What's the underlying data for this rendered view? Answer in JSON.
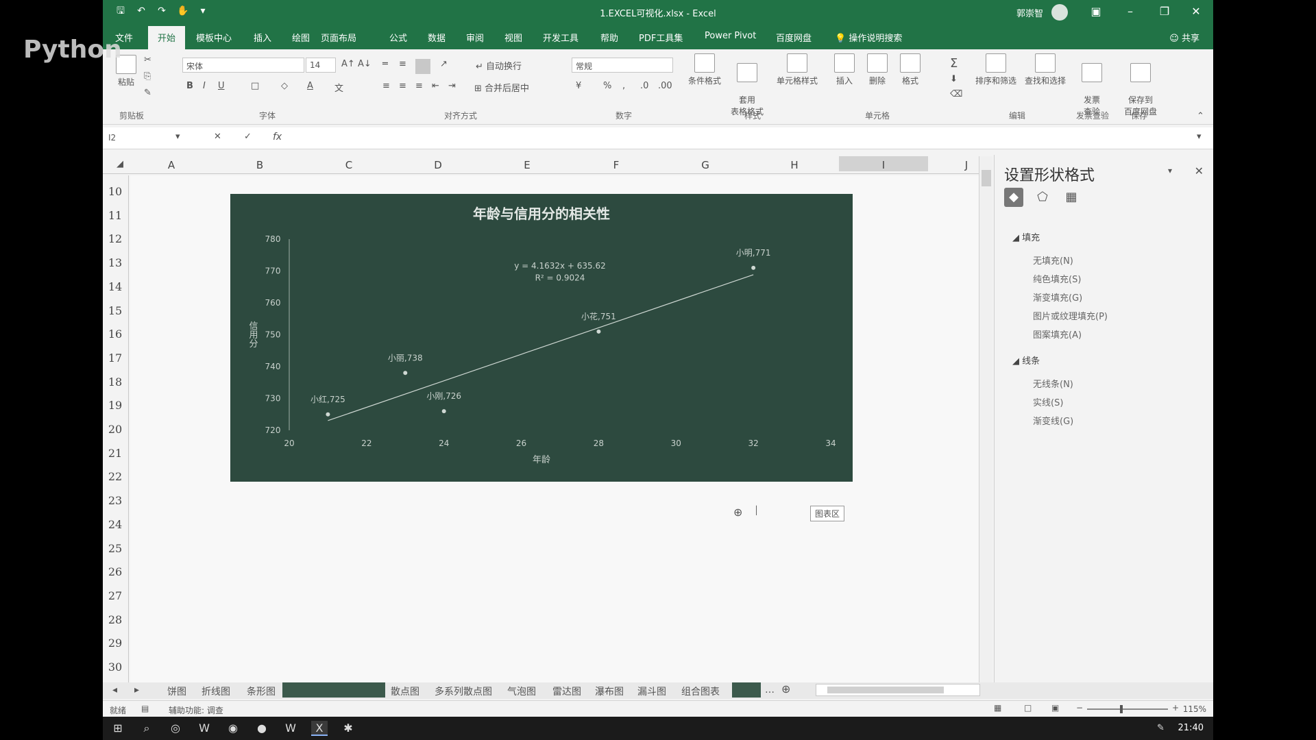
{
  "watermark": "Python",
  "titlebar": {
    "doc_title": "1.EXCEL可视化.xlsx - Excel",
    "user": "郭崇智",
    "qat_icons": [
      "save-icon",
      "undo-icon",
      "redo-icon",
      "touch-mode-icon",
      "customize-icon"
    ],
    "window_buttons": [
      "ribbon-display-icon",
      "minimize-icon",
      "restore-icon",
      "close-icon"
    ]
  },
  "tabs": {
    "items": [
      "文件",
      "开始",
      "模板中心",
      "插入",
      "绘图",
      "页面布局",
      "公式",
      "数据",
      "审阅",
      "视图",
      "开发工具",
      "帮助",
      "PDF工具集",
      "Power Pivot",
      "百度网盘",
      "操作说明搜索"
    ],
    "active": "开始",
    "share": "共享"
  },
  "ribbon": {
    "font_name": "宋体",
    "font_size": "14",
    "number_format": "常规",
    "wrap_text": "自动换行",
    "merge_center": "合并后居中",
    "groups": [
      "剪贴板",
      "字体",
      "对齐方式",
      "数字",
      "样式",
      "单元格",
      "编辑",
      "发票查验",
      "保存"
    ],
    "paste": "粘贴",
    "buttons": {
      "cond_format": "条件格式",
      "table_format": "套用\n表格格式",
      "cell_style": "单元格样式",
      "insert": "插入",
      "delete": "删除",
      "format": "格式",
      "sort_filter": "排序和筛选",
      "find_select": "查找和选择",
      "invoice_check": "发票\n查验",
      "save_baidu": "保存到\n百度网盘"
    }
  },
  "formula_bar": {
    "name_box": "I2",
    "fx": "fx"
  },
  "columns": [
    "A",
    "B",
    "C",
    "D",
    "E",
    "F",
    "G",
    "H",
    "I",
    "J"
  ],
  "selected_column": "I",
  "rows": [
    "10",
    "11",
    "12",
    "13",
    "14",
    "15",
    "16",
    "17",
    "18",
    "19",
    "20",
    "21",
    "22",
    "23",
    "24",
    "25",
    "26",
    "27",
    "28",
    "29",
    "30"
  ],
  "chart_data": {
    "type": "scatter",
    "title": "年龄与信用分的相关性",
    "xlabel": "年龄",
    "ylabel": "信用分",
    "xlim": [
      20,
      34
    ],
    "ylim": [
      720,
      780
    ],
    "xticks": [
      "20",
      "22",
      "24",
      "26",
      "28",
      "30",
      "32",
      "34"
    ],
    "yticks": [
      "720",
      "730",
      "740",
      "750",
      "760",
      "770",
      "780"
    ],
    "grid": false,
    "points": [
      {
        "label": "小红,725",
        "x": 21,
        "y": 725
      },
      {
        "label": "小丽,738",
        "x": 23,
        "y": 738
      },
      {
        "label": "小刚,726",
        "x": 24,
        "y": 726
      },
      {
        "label": "小花,751",
        "x": 28,
        "y": 751
      },
      {
        "label": "小明,771",
        "x": 32,
        "y": 771
      }
    ],
    "trendline": {
      "slope": 4.1632,
      "intercept": 635.62,
      "x_range": [
        21,
        32
      ],
      "equation": "y = 4.1632x + 635.62",
      "r_squared": "R² = 0.9024"
    },
    "background": "#2d4a3f",
    "point_color": "#cfd8d3",
    "line_color": "#cfd8d3"
  },
  "chart_area_tip": "图表区",
  "format_pane": {
    "title": "设置形状格式",
    "fill_section": "填充",
    "fill_options": [
      "无填充(N)",
      "纯色填充(S)",
      "渐变填充(G)",
      "图片或纹理填充(P)",
      "图案填充(A)"
    ],
    "line_section": "线条",
    "line_options": [
      "无线条(N)",
      "实线(S)",
      "渐变线(G)"
    ]
  },
  "sheet_tabs": [
    "饼图",
    "折线图",
    "条形图",
    "",
    "散点图",
    "多系列散点图",
    "气泡图",
    "雷达图",
    "瀑布图",
    "漏斗图",
    "组合图表"
  ],
  "status": {
    "ready": "就绪",
    "accessibility": "辅助功能: 调查",
    "zoom": "115%",
    "zoom_fraction": 0.42
  },
  "taskbar": {
    "clock": "21:40",
    "icons": [
      "windows-icon",
      "search-icon",
      "browser-icon",
      "app-w-icon",
      "app-chat-icon",
      "chrome-icon",
      "wps-icon",
      "excel-icon",
      "app-gear-icon"
    ]
  }
}
